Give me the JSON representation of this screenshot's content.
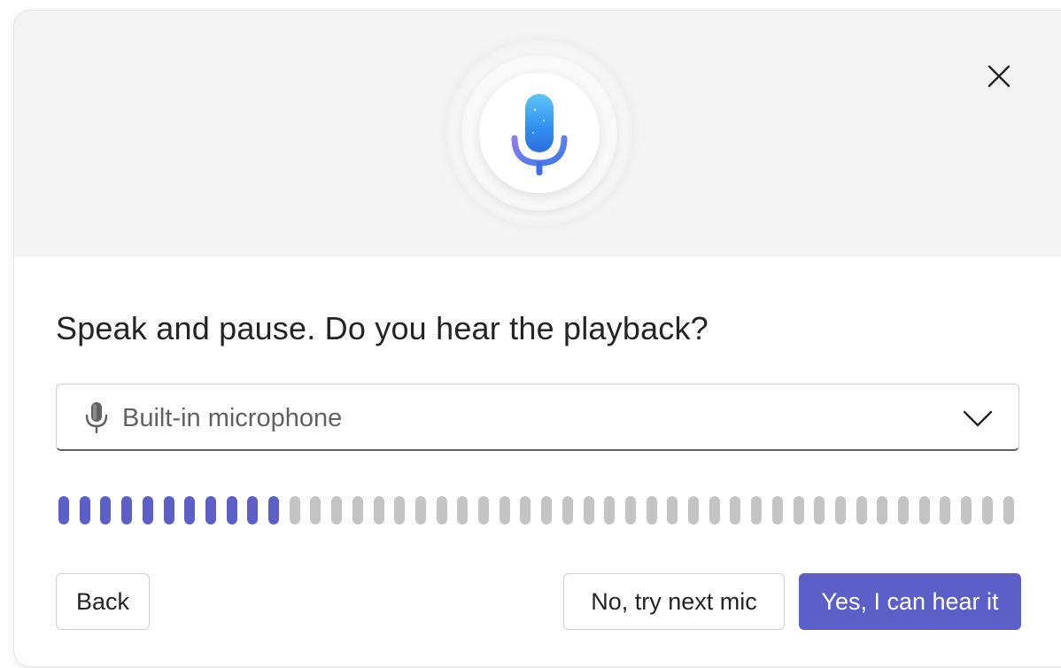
{
  "dialog": {
    "title": "Speak and pause. Do you hear the playback?",
    "close_icon": "close-icon",
    "hero_icon": "microphone-icon"
  },
  "mic_select": {
    "icon": "microphone-icon",
    "value": "Built-in microphone",
    "chevron_icon": "chevron-down-icon"
  },
  "level_meter": {
    "total_segments": 46,
    "active_segments": 11,
    "level": 0.239,
    "active_color": "#5b5fc7",
    "inactive_color": "#c4c4c4"
  },
  "buttons": {
    "back_label": "Back",
    "next_mic_label": "No, try next mic",
    "confirm_label": "Yes, I can hear it"
  },
  "colors": {
    "accent": "#5b5fc7",
    "hero_background": "#f4f4f4",
    "title_text": "#242424"
  }
}
